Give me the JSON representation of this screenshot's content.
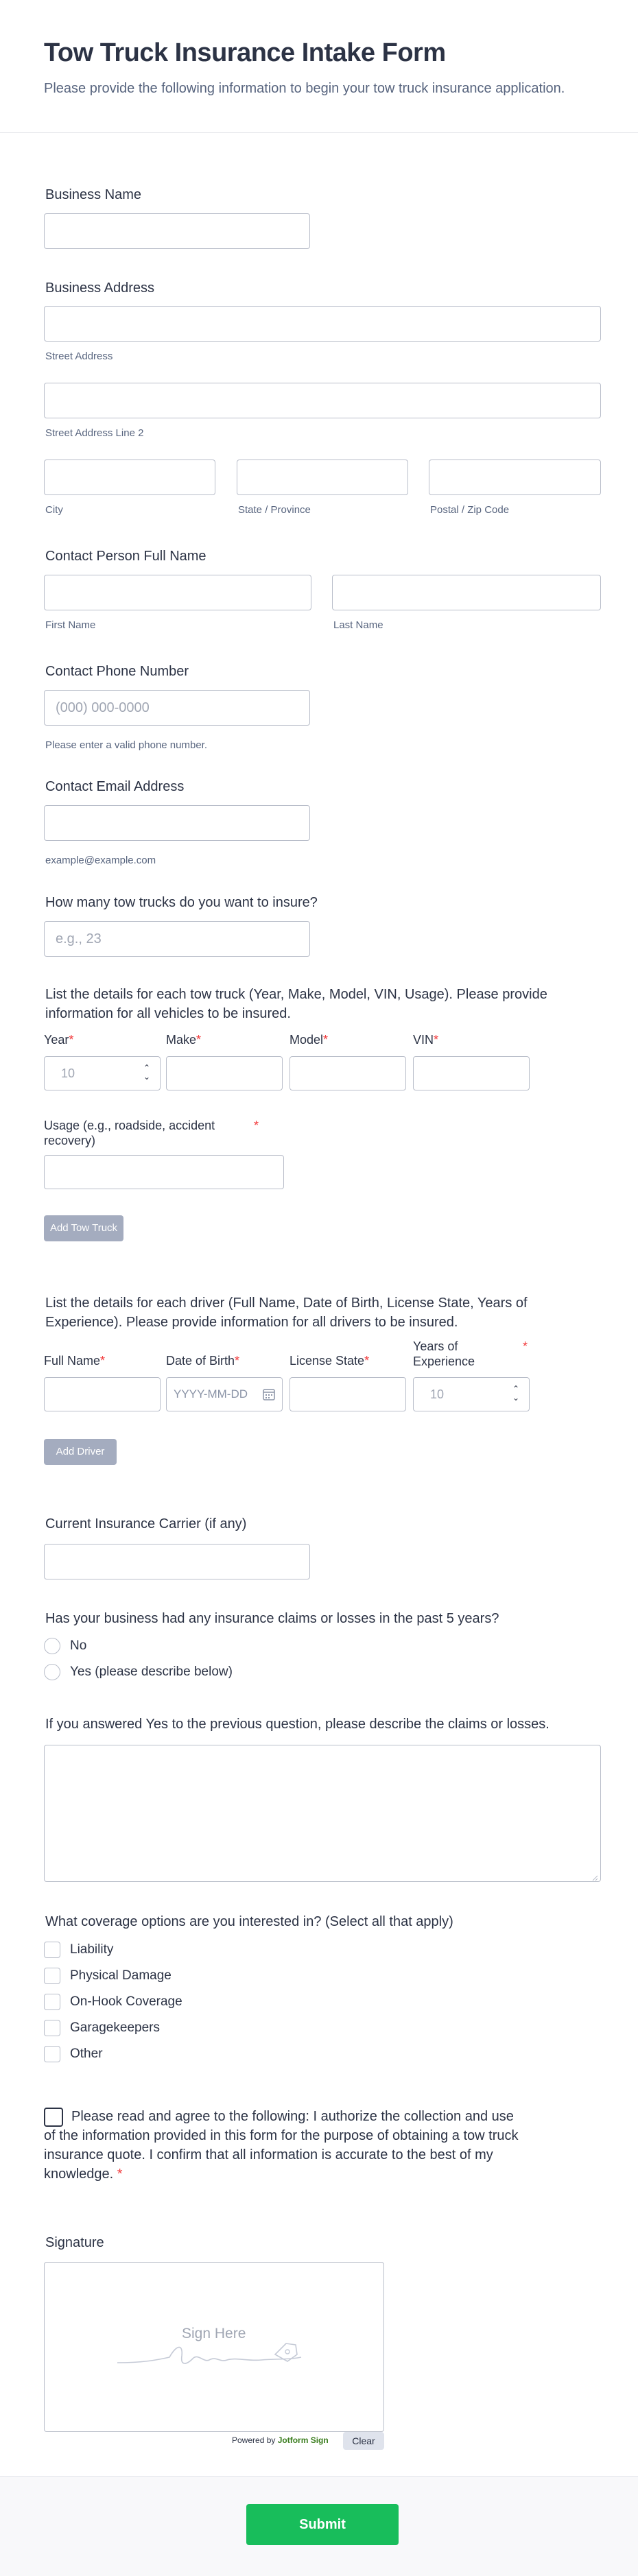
{
  "header": {
    "title": "Tow Truck Insurance Intake Form",
    "subtitle": "Please provide the following information to begin your tow truck insurance application."
  },
  "business_name": {
    "label": "Business Name"
  },
  "business_address": {
    "label": "Business Address",
    "street": "Street Address",
    "street2": "Street Address Line 2",
    "city": "City",
    "state": "State / Province",
    "zip": "Postal / Zip Code"
  },
  "contact_name": {
    "label": "Contact Person Full Name",
    "first": "First Name",
    "last": "Last Name"
  },
  "phone": {
    "label": "Contact Phone Number",
    "placeholder": "(000) 000-0000",
    "hint": "Please enter a valid phone number."
  },
  "email": {
    "label": "Contact Email Address",
    "hint": "example@example.com"
  },
  "truck_count": {
    "label": "How many tow trucks do you want to insure?",
    "placeholder": "e.g., 23"
  },
  "trucks": {
    "label": "List the details for each tow truck (Year, Make, Model, VIN, Usage). Please provide information for all vehicles to be insured.",
    "year": "Year",
    "year_value": "10",
    "make": "Make",
    "model": "Model",
    "vin": "VIN",
    "usage": "Usage (e.g., roadside, accident recovery)",
    "add": "Add Tow Truck"
  },
  "drivers": {
    "label": "List the details for each driver (Full Name, Date of Birth, License State, Years of Experience). Please provide information for all drivers to be insured.",
    "full_name": "Full Name",
    "dob": "Date of Birth",
    "dob_placeholder": "YYYY-MM-DD",
    "license_state": "License State",
    "years": "Years of Experience",
    "years_value": "10",
    "add": "Add Driver"
  },
  "carrier": {
    "label": "Current Insurance Carrier (if any)"
  },
  "claims": {
    "label": "Has your business had any insurance claims or losses in the past 5 years?",
    "options": [
      "No",
      "Yes (please describe below)"
    ]
  },
  "claims_desc": {
    "label": "If you answered Yes to the previous question, please describe the claims or losses."
  },
  "coverage": {
    "label": "What coverage options are you interested in? (Select all that apply)",
    "options": [
      "Liability",
      "Physical Damage",
      "On-Hook Coverage",
      "Garagekeepers",
      "Other"
    ]
  },
  "agreement": {
    "text": "Please read and agree to the following: I authorize the collection and use of the information provided in this form for the purpose of obtaining a tow truck insurance quote. I confirm that all information is accurate to the best of my knowledge."
  },
  "signature": {
    "label": "Signature",
    "placeholder": "Sign Here",
    "powered": "Powered by",
    "brand": "Jotform Sign",
    "clear": "Clear"
  },
  "submit": "Submit",
  "colors": {
    "accent_green": "#18bd5b",
    "required_red": "#f23a3c",
    "disabled_button": "#a4acbf"
  }
}
